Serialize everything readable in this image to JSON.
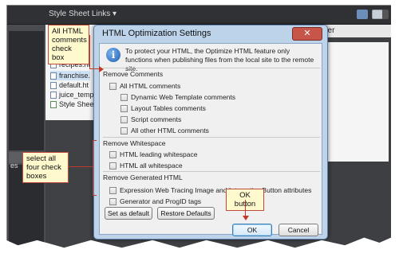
{
  "app": {
    "panel_title": "Style Sheet Links",
    "menu_arrow": "▾",
    "right_panel_label": "der",
    "left_panel_label": "es"
  },
  "files": [
    {
      "name": "recipes.ht",
      "kind": "html",
      "selected": false
    },
    {
      "name": "franchise.",
      "kind": "html",
      "selected": true
    },
    {
      "name": "default.ht",
      "kind": "html",
      "selected": false
    },
    {
      "name": "juice_temp",
      "kind": "template",
      "selected": false
    },
    {
      "name": "Style Shee",
      "kind": "css",
      "selected": false
    }
  ],
  "dialog": {
    "title": "HTML Optimization Settings",
    "close_glyph": "✕",
    "info_icon": "info-icon",
    "info_text": "To protect your HTML, the Optimize HTML feature only functions when publishing files from the local site to the remote site.",
    "sections": {
      "comments": {
        "label": "Remove Comments",
        "all": "All HTML comments",
        "items": [
          "Dynamic Web Template comments",
          "Layout Tables comments",
          "Script comments",
          "All other HTML comments"
        ]
      },
      "whitespace": {
        "label": "Remove Whitespace",
        "items": [
          "HTML leading whitespace",
          "HTML all whitespace"
        ]
      },
      "generated": {
        "label": "Remove Generated HTML",
        "items": [
          "Expression Web Tracing Image and Interactive Button attributes",
          "Generator and ProgID tags"
        ]
      }
    },
    "buttons": {
      "set_default": "Set as default",
      "restore_defaults": "Restore Defaults",
      "ok": "OK",
      "cancel": "Cancel"
    }
  },
  "callouts": {
    "comments_checkbox": "All HTML comments check box",
    "select_four": "select all four check boxes",
    "ok_button": "OK button"
  },
  "colors": {
    "callout_bg": "#fffacd",
    "callout_border": "#c04a3c",
    "dialog_frame": "#bcd3ea",
    "close_button": "#c7554a"
  }
}
